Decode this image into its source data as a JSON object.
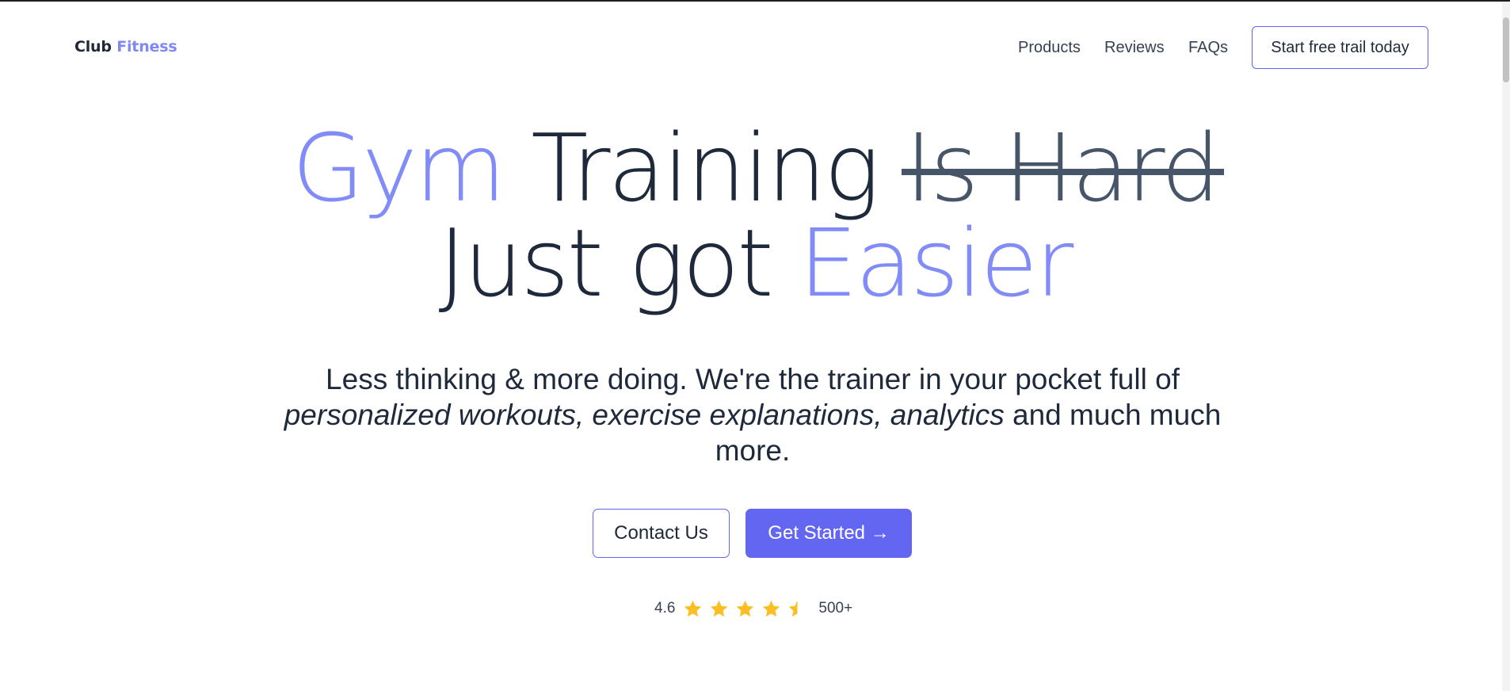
{
  "brand": {
    "name_part1": "Club",
    "name_part2": "Fitness"
  },
  "nav": {
    "items": [
      {
        "label": "Products"
      },
      {
        "label": "Reviews"
      },
      {
        "label": "FAQs"
      }
    ],
    "cta_label": "Start free trail today"
  },
  "hero": {
    "headline": {
      "line1": {
        "accent_word": "Gym",
        "word": "Training",
        "struck_words": "Is Hard"
      },
      "line2": {
        "words": "Just got",
        "accent_word": "Easier"
      }
    },
    "subcopy": {
      "intro": "Less thinking & more doing. We're the trainer in your pocket full of",
      "emphasis": "personalized workouts, exercise explanations, analytics",
      "outro": "and much much more."
    },
    "buttons": {
      "contact_label": "Contact Us",
      "get_started_label": "Get Started →"
    },
    "rating": {
      "score": "4.6",
      "stars_value": 4.5,
      "stars_max": 5,
      "count": "500+"
    }
  },
  "colors": {
    "accent": "#818cf8",
    "primary_button": "#6366f1",
    "text_dark": "#1e293b",
    "strike": "#475569",
    "star": "#fbbf24"
  },
  "icons": {
    "star": "star-icon",
    "half_star": "star-half-icon"
  }
}
